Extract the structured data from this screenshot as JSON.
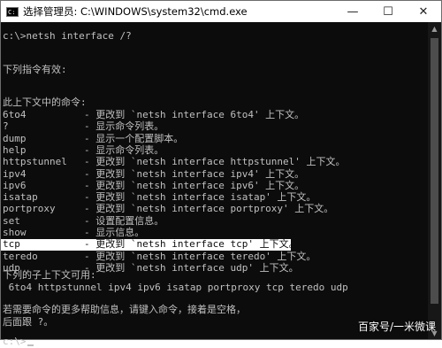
{
  "window": {
    "title": "选择管理员: C:\\WINDOWS\\system32\\cmd.exe",
    "app_icon": "cmd-icon",
    "controls": {
      "minimize": "—",
      "maximize": "☐",
      "close": "✕"
    }
  },
  "console": {
    "prompt1": "c:\\>netsh interface /?",
    "heading1": "下列指令有效:",
    "heading2": "此上下文中的命令:",
    "commands": [
      {
        "cmd": "6to4",
        "desc": "- 更改到 `netsh interface 6to4' 上下文。"
      },
      {
        "cmd": "?",
        "desc": "- 显示命令列表。"
      },
      {
        "cmd": "dump",
        "desc": "- 显示一个配置脚本。"
      },
      {
        "cmd": "help",
        "desc": "- 显示命令列表。"
      },
      {
        "cmd": "httpstunnel",
        "desc": "- 更改到 `netsh interface httpstunnel' 上下文。"
      },
      {
        "cmd": "ipv4",
        "desc": "- 更改到 `netsh interface ipv4' 上下文。"
      },
      {
        "cmd": "ipv6",
        "desc": "- 更改到 `netsh interface ipv6' 上下文。"
      },
      {
        "cmd": "isatap",
        "desc": "- 更改到 `netsh interface isatap' 上下文。"
      },
      {
        "cmd": "portproxy",
        "desc": "- 更改到 `netsh interface portproxy' 上下文。"
      },
      {
        "cmd": "set",
        "desc": "- 设置配置信息。"
      },
      {
        "cmd": "show",
        "desc": "- 显示信息。"
      },
      {
        "cmd": "tcp",
        "desc": "- 更改到 `netsh interface tcp' 上下文。"
      },
      {
        "cmd": "teredo",
        "desc": "- 更改到 `netsh interface teredo' 上下文。"
      },
      {
        "cmd": "udp",
        "desc": "- 更改到 `netsh interface udp' 上下文。"
      }
    ],
    "selected_command": "tcp",
    "heading3": "下列的子上下文可用:",
    "subcontexts": " 6to4 httpstunnel ipv4 ipv6 isatap portproxy tcp teredo udp",
    "help1": "若需要命令的更多帮助信息，请键入命令，接着是空格，",
    "help2": "后面跟 ?。",
    "prompt2": "c:\\>"
  },
  "watermark": "百家号/一米微课",
  "colors": {
    "background": "#0c0c0c",
    "text": "#c0c0c0",
    "highlight": "#ffffff"
  }
}
